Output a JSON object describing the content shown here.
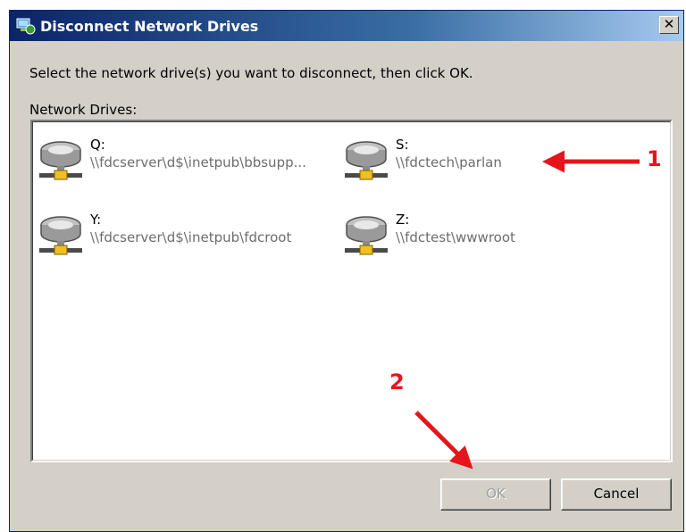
{
  "window": {
    "title": "Disconnect Network Drives",
    "close_glyph": "✕"
  },
  "instruction": "Select the network drive(s) you want to disconnect, then click OK.",
  "group_label": "Network Drives:",
  "drives": [
    {
      "letter": "Q:",
      "path": "\\\\fdcserver\\d$\\inetpub\\bbsupp...",
      "icon": "network-drive-icon"
    },
    {
      "letter": "S:",
      "path": "\\\\fdctech\\parlan",
      "icon": "network-drive-icon"
    },
    {
      "letter": "Y:",
      "path": "\\\\fdcserver\\d$\\inetpub\\fdcroot",
      "icon": "network-drive-icon"
    },
    {
      "letter": "Z:",
      "path": "\\\\fdctest\\wwwroot",
      "icon": "network-drive-icon"
    }
  ],
  "buttons": {
    "ok": "OK",
    "cancel": "Cancel",
    "ok_enabled": false
  },
  "annotations": {
    "arrow1_label": "1",
    "arrow2_label": "2",
    "color": "#e8141c"
  },
  "colors": {
    "title_bar": "#0a246a",
    "dialog_bg": "#d4d0c8",
    "disabled_text": "#a0a0a0"
  }
}
